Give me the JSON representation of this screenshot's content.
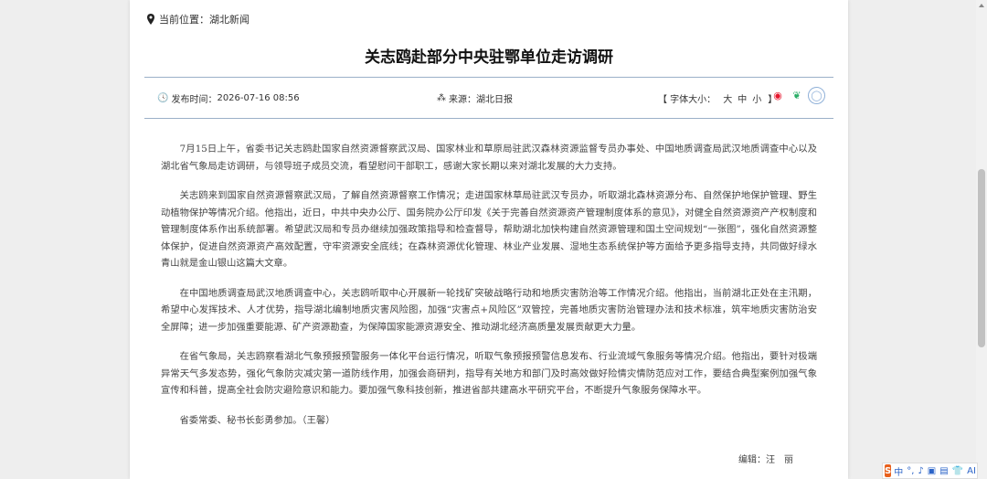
{
  "location": {
    "label": "当前位置：",
    "value": "湖北新闻"
  },
  "article": {
    "title": "关志鸥赴部分中央驻鄂单位走访调研",
    "publish_label": "发布时间：",
    "publish_time": "2026-07-16 08:56",
    "source_label": "来源：",
    "source": "湖北日报",
    "font_size_label": "【 字体大小：",
    "font_sizes": [
      "大",
      "中",
      "小"
    ],
    "font_size_close": "】",
    "paragraphs": [
      "7月15日上午，省委书记关志鸥赴国家自然资源督察武汉局、国家林业和草原局驻武汉森林资源监督专员办事处、中国地质调查局武汉地质调查中心以及湖北省气象局走访调研，与领导班子成员交流，看望慰问干部职工，感谢大家长期以来对湖北发展的大力支持。",
      "关志鸥来到国家自然资源督察武汉局，了解自然资源督察工作情况；走进国家林草局驻武汉专员办，听取湖北森林资源分布、自然保护地保护管理、野生动植物保护等情况介绍。他指出，近日，中共中央办公厅、国务院办公厅印发《关于完善自然资源资产管理制度体系的意见》，对健全自然资源资产产权制度和管理制度体系作出系统部署。希望武汉局和专员办继续加强政策指导和检查督导，帮助湖北加快构建自然资源管理和国土空间规划“一张图”，强化自然资源整体保护，促进自然资源资产高效配置，守牢资源安全底线；在森林资源优化管理、林业产业发展、湿地生态系统保护等方面给予更多指导支持，共同做好绿水青山就是金山银山这篇大文章。",
      "在中国地质调查局武汉地质调查中心，关志鸥听取中心开展新一轮找矿突破战略行动和地质灾害防治等工作情况介绍。他指出，当前湖北正处在主汛期，希望中心发挥技术、人才优势，指导湖北编制地质灾害风险图，加强“灾害点+风险区”双管控，完善地质灾害防治管理办法和技术标准，筑牢地质灾害防治安全屏障；进一步加强重要能源、矿产资源勘查，为保障国家能源资源安全、推动湖北经济高质量发展贡献更大力量。",
      "在省气象局，关志鸥察看湖北气象预报预警服务一体化平台运行情况，听取气象预报预警信息发布、行业流域气象服务等情况介绍。他指出，要针对极端异常天气多发态势，强化气象防灾减灾第一道防线作用，加强会商研判，指导有关地方和部门及时高效做好险情灾情防范应对工作，要结合典型案例加强气象宣传和科普，提高全社会防灾避险意识和能力。要加强气象科技创新，推进省部共建高水平研究平台，不断提升气象服务保障水平。",
      "省委常委、秘书长彭勇参加。（王馨）"
    ],
    "editor": "编辑：汪　丽"
  },
  "ime": {
    "mode": "中",
    "items": [
      "°,",
      "♪",
      "▣",
      "▤",
      "👕",
      "AI"
    ]
  }
}
